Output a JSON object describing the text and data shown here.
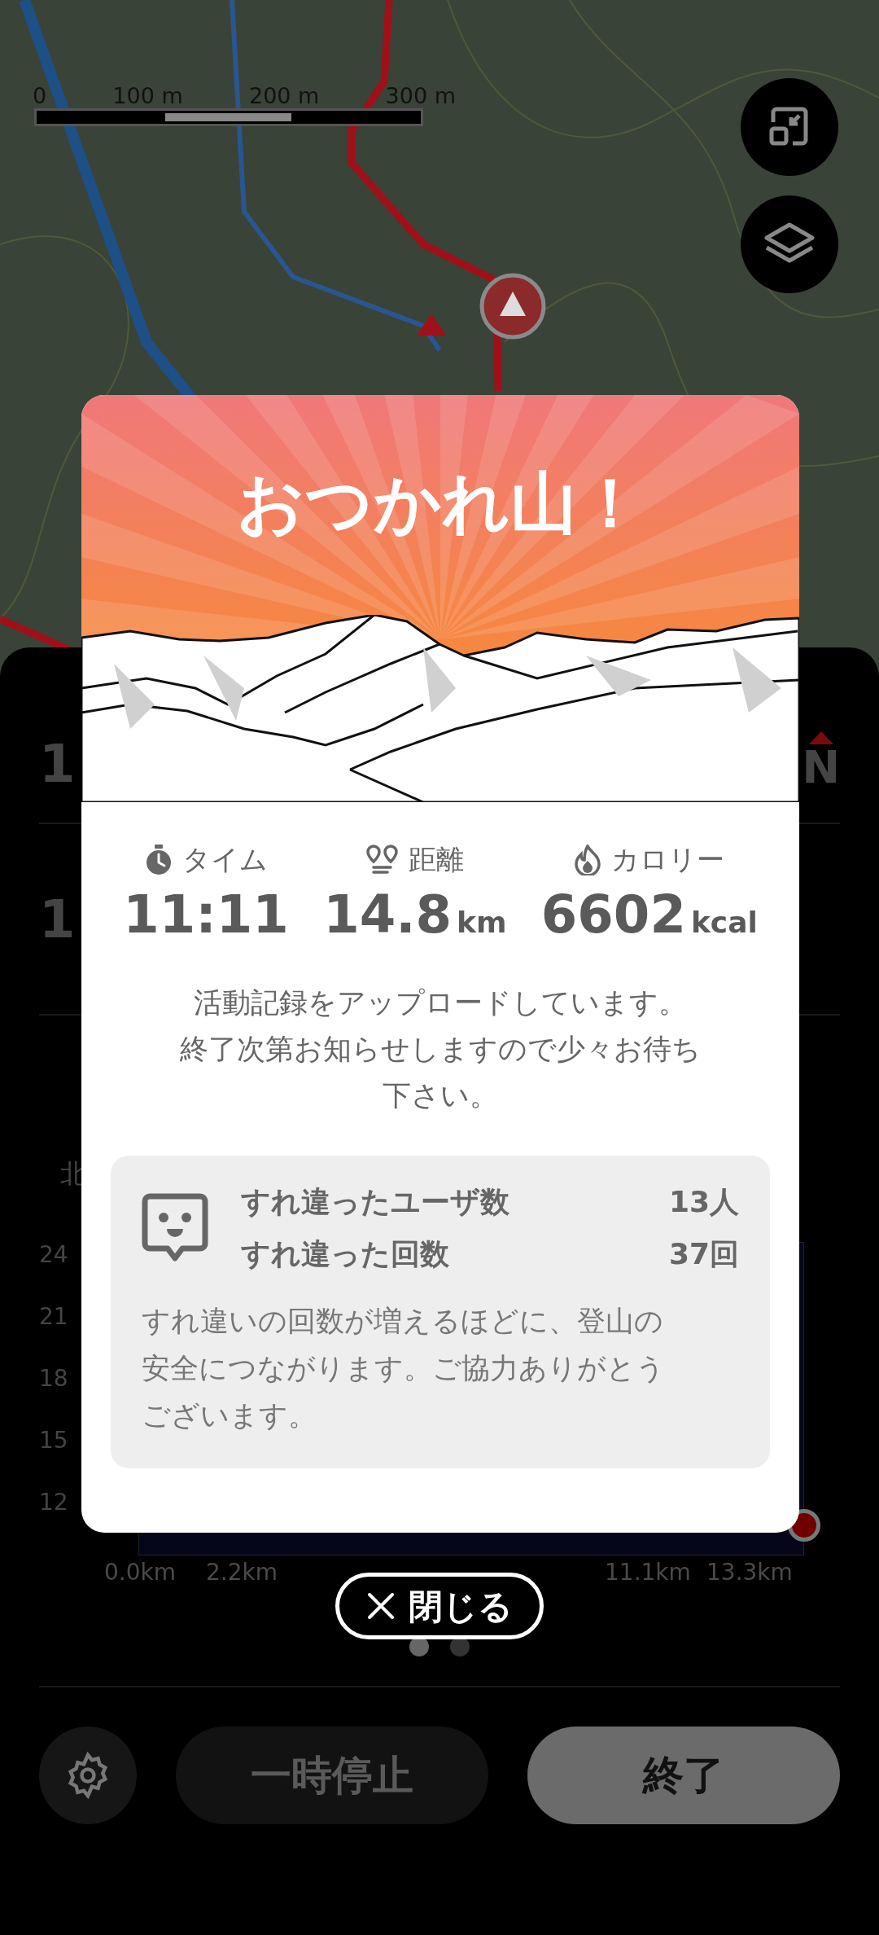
{
  "map": {
    "scale_labels": [
      "0",
      "100 m",
      "200 m",
      "300 m"
    ]
  },
  "sheet": {
    "header_value": "1",
    "compass": "N",
    "stat_value": "1",
    "chart_label": "北",
    "y_ticks": [
      "24",
      "21",
      "18",
      "15",
      "12"
    ],
    "x_ticks": [
      "0.0km",
      "2.2km",
      "11.1km",
      "13.3km"
    ]
  },
  "pager": [
    {
      "selected": true
    },
    {
      "selected": false
    }
  ],
  "actions": {
    "pause": "一時停止",
    "finish": "終了"
  },
  "dialog": {
    "title": "おつかれ山！",
    "stats": [
      {
        "kind": "time",
        "label": "タイム",
        "value": "11:11"
      },
      {
        "kind": "distance",
        "label": "距離",
        "value": "14.8",
        "unit": "km"
      },
      {
        "kind": "calories",
        "label": "カロリー",
        "value": "6602",
        "unit": "kcal"
      }
    ],
    "message": [
      "活動記録をアップロードしています。",
      "終了次第お知らせしますので少々お待ち下さい。"
    ],
    "encounters": {
      "rows": [
        {
          "label": "すれ違ったユーザ数",
          "value": "13人"
        },
        {
          "label": "すれ違った回数",
          "value": "37回"
        }
      ],
      "note": "すれ違いの回数が増えるほどに、登山の安全につながります。ご協力ありがとうございます。"
    }
  },
  "close": {
    "label": "閉じる"
  }
}
